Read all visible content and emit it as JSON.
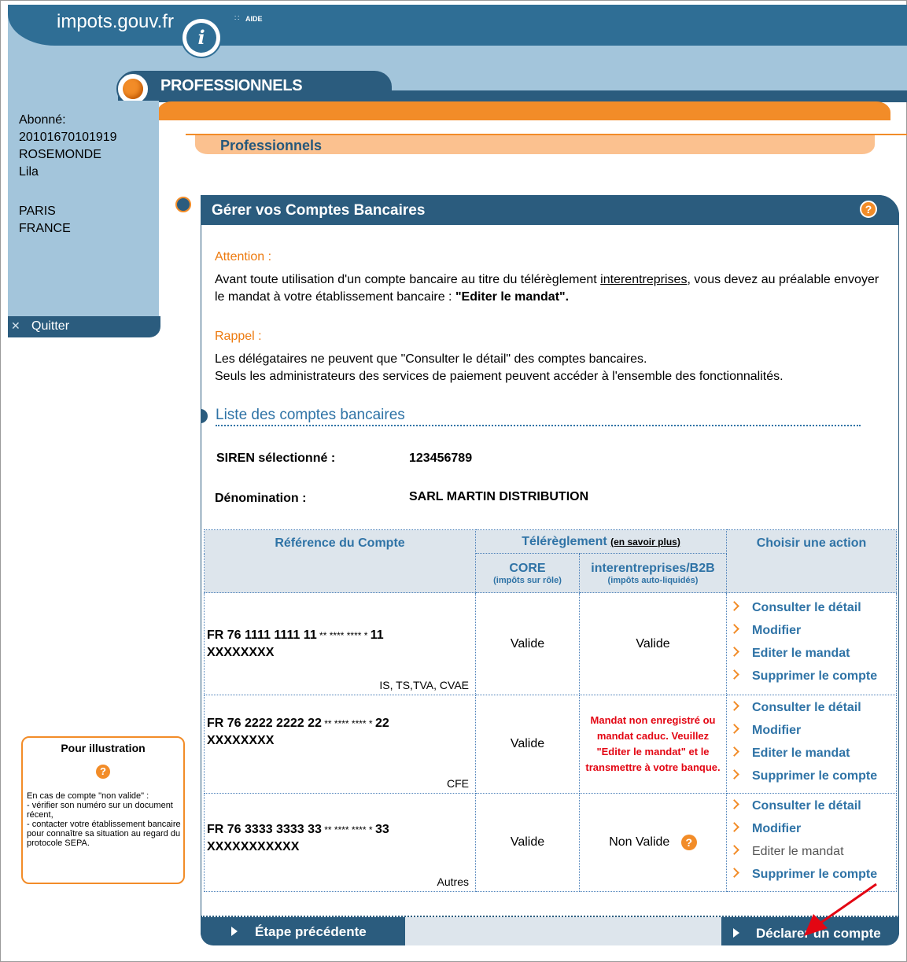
{
  "header": {
    "logo_text": "impots.gouv.fr",
    "logo_mark": "i",
    "aide_dots": "∷",
    "aide": "AIDE",
    "section": "PROFESSIONNELS",
    "breadcrumb": "Professionnels"
  },
  "sidebar": {
    "subscriber_label": "Abonné:",
    "subscriber_id": "20101670101919",
    "last_name": "ROSEMONDE",
    "first_name": "Lila",
    "city": "PARIS",
    "country": "FRANCE",
    "quit_label": "Quitter"
  },
  "illustration": {
    "title": "Pour illustration",
    "line1": "En cas de compte \"non valide\" :",
    "line2": "- vérifier son numéro sur un document récent,",
    "line3": "- contacter votre établissement bancaire pour connaître sa situation au regard du protocole SEPA."
  },
  "panel": {
    "title": "Gérer vos Comptes Bancaires",
    "help": "?",
    "attention_label": "Attention :",
    "attention_text_a": "Avant toute utilisation d'un compte bancaire au titre du télérèglement ",
    "attention_link": "interentreprises",
    "attention_text_b": ", vous devez au préalable envoyer le mandat à votre établissement bancaire : ",
    "attention_bold": "\"Editer le mandat\".",
    "rappel_label": "Rappel :",
    "rappel_line1": "Les délégataires ne peuvent que \"Consulter le détail\" des comptes bancaires.",
    "rappel_line2": "Seuls les administrateurs des services de paiement peuvent accéder à l'ensemble des fonctionnalités.",
    "list_title": "Liste des comptes bancaires",
    "siren_label": "SIREN sélectionné :",
    "siren_value": "123456789",
    "denomination_label": "Dénomination :",
    "denomination_value": "SARL MARTIN DISTRIBUTION"
  },
  "table": {
    "col_ref": "Référence du Compte",
    "col_tele": "Télérèglement",
    "col_tele_link": "(en savoir plus)",
    "col_action": "Choisir une action",
    "col_core": "CORE",
    "col_core_sub": "(impôts sur rôle)",
    "col_b2b": "interentreprises/B2B",
    "col_b2b_sub": "(impôts auto-liquidés)",
    "rows": [
      {
        "ref_a": "FR 76 1111 1111 11",
        "ref_stars": " **  ****  ****  * ",
        "ref_b": "11",
        "ref_c": "XXXXXXXX",
        "tag": "IS, TS,TVA, CVAE",
        "core": "Valide",
        "b2b": "Valide",
        "actions": [
          "Consulter le détail",
          "Modifier",
          "Editer le mandat",
          "Supprimer le compte"
        ]
      },
      {
        "ref_a": "FR 76 2222 2222 22",
        "ref_stars": " **  ****  ****  * ",
        "ref_b": "22",
        "ref_c": "XXXXXXXX",
        "tag": "CFE",
        "core": "Valide",
        "b2b_msg": "Mandat non enregistré ou mandat caduc. Veuillez \"Editer le mandat\" et le transmettre à votre banque.",
        "actions": [
          "Consulter le détail",
          "Modifier",
          "Editer le mandat",
          "Supprimer le compte"
        ]
      },
      {
        "ref_a": "FR 76 3333 3333 33",
        "ref_stars": " **  ****  ****  * ",
        "ref_b": "33",
        "ref_c": "XXXXXXXXXXX",
        "tag": "Autres",
        "core": "Valide",
        "b2b": "Non Valide",
        "b2b_help": "?",
        "actions": [
          "Consulter le détail",
          "Modifier",
          "Editer le mandat",
          "Supprimer le compte"
        ]
      }
    ]
  },
  "footer": {
    "prev_label": "Étape précédente",
    "declare_label": "Déclarer un compte"
  },
  "colors": {
    "navy": "#2b5c7e",
    "orange": "#f28c28",
    "link_blue": "#2f73a6",
    "error_red": "#e30613"
  }
}
